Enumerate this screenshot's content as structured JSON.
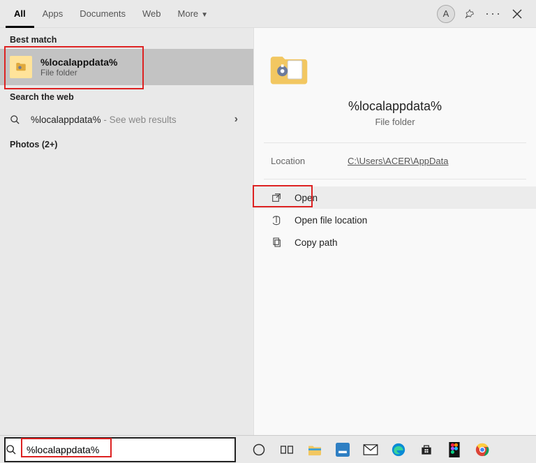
{
  "tabs": {
    "all": "All",
    "apps": "Apps",
    "documents": "Documents",
    "web": "Web",
    "more": "More"
  },
  "header": {
    "avatar_letter": "A"
  },
  "left": {
    "best_match_label": "Best match",
    "result_title": "%localappdata%",
    "result_sub": "File folder",
    "search_web_label": "Search the web",
    "web_query": "%localappdata%",
    "web_suffix": " - See web results",
    "photos_label": "Photos (2+)"
  },
  "preview": {
    "title": "%localappdata%",
    "sub": "File folder",
    "location_label": "Location",
    "location_value": "C:\\Users\\ACER\\AppData",
    "open": "Open",
    "open_file_location": "Open file location",
    "copy_path": "Copy path"
  },
  "search": {
    "value": "%localappdata%"
  }
}
